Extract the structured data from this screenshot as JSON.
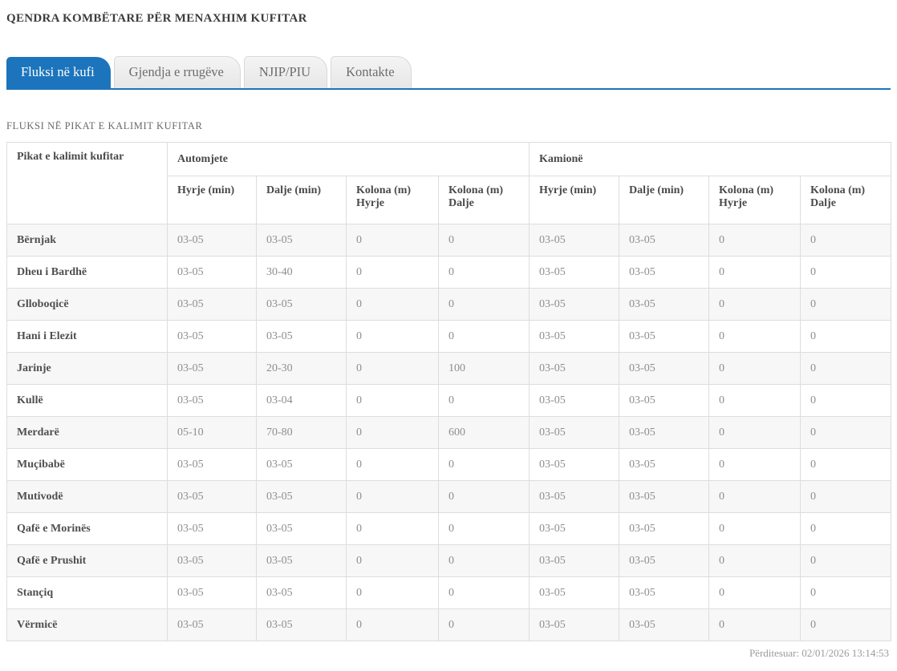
{
  "header": {
    "title": "QENDRA KOMBËTARE PËR MENAXHIM KUFITAR"
  },
  "tabs": [
    {
      "label": "Fluksi në kufi",
      "active": true
    },
    {
      "label": "Gjendja e rrugëve",
      "active": false
    },
    {
      "label": "NJIP/PIU",
      "active": false
    },
    {
      "label": "Kontakte",
      "active": false
    }
  ],
  "section": {
    "title": "FLUKSI NË PIKAT E KALIMIT KUFITAR"
  },
  "table": {
    "corner_header": "Pikat e kalimit kufitar",
    "groups": [
      {
        "label": "Automjete"
      },
      {
        "label": "Kamionë"
      }
    ],
    "sub_headers": [
      "Hyrje (min)",
      "Dalje (min)",
      "Kolona (m)\nHyrje",
      "Kolona (m)\nDalje",
      "Hyrje (min)",
      "Dalje (min)",
      "Kolona (m)\nHyrje",
      "Kolona (m)\nDalje"
    ],
    "rows": [
      {
        "name": "Bërnjak",
        "values": [
          "03-05",
          "03-05",
          "0",
          "0",
          "03-05",
          "03-05",
          "0",
          "0"
        ]
      },
      {
        "name": "Dheu i Bardhë",
        "values": [
          "03-05",
          "30-40",
          "0",
          "0",
          "03-05",
          "03-05",
          "0",
          "0"
        ]
      },
      {
        "name": "Glloboqicë",
        "values": [
          "03-05",
          "03-05",
          "0",
          "0",
          "03-05",
          "03-05",
          "0",
          "0"
        ]
      },
      {
        "name": "Hani i Elezit",
        "values": [
          "03-05",
          "03-05",
          "0",
          "0",
          "03-05",
          "03-05",
          "0",
          "0"
        ]
      },
      {
        "name": "Jarinje",
        "values": [
          "03-05",
          "20-30",
          "0",
          "100",
          "03-05",
          "03-05",
          "0",
          "0"
        ]
      },
      {
        "name": "Kullë",
        "values": [
          "03-05",
          "03-04",
          "0",
          "0",
          "03-05",
          "03-05",
          "0",
          "0"
        ]
      },
      {
        "name": "Merdarë",
        "values": [
          "05-10",
          "70-80",
          "0",
          "600",
          "03-05",
          "03-05",
          "0",
          "0"
        ]
      },
      {
        "name": "Muçibabë",
        "values": [
          "03-05",
          "03-05",
          "0",
          "0",
          "03-05",
          "03-05",
          "0",
          "0"
        ]
      },
      {
        "name": "Mutivodë",
        "values": [
          "03-05",
          "03-05",
          "0",
          "0",
          "03-05",
          "03-05",
          "0",
          "0"
        ]
      },
      {
        "name": "Qafë e Morinës",
        "values": [
          "03-05",
          "03-05",
          "0",
          "0",
          "03-05",
          "03-05",
          "0",
          "0"
        ]
      },
      {
        "name": "Qafë e Prushit",
        "values": [
          "03-05",
          "03-05",
          "0",
          "0",
          "03-05",
          "03-05",
          "0",
          "0"
        ]
      },
      {
        "name": "Stançiq",
        "values": [
          "03-05",
          "03-05",
          "0",
          "0",
          "03-05",
          "03-05",
          "0",
          "0"
        ]
      },
      {
        "name": "Vërmicë",
        "values": [
          "03-05",
          "03-05",
          "0",
          "0",
          "03-05",
          "03-05",
          "0",
          "0"
        ]
      }
    ]
  },
  "footer": {
    "updated": "Përditesuar: 02/01/2026 13:14:53"
  },
  "colors": {
    "accent_blue": "#1c75bc",
    "row_stripe": "#f7f7f7",
    "border": "#dddddd"
  }
}
